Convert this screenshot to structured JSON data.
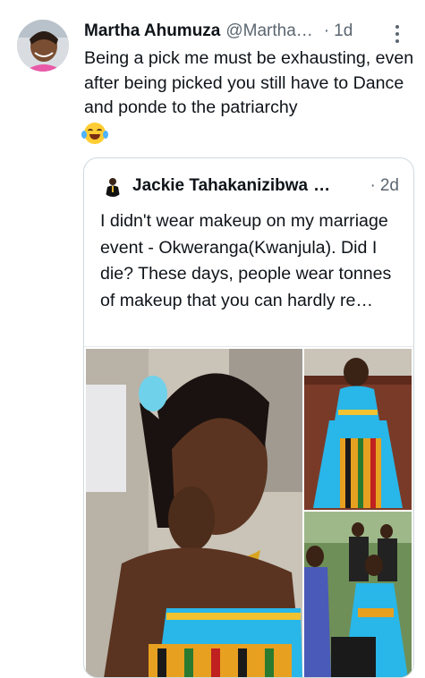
{
  "tweet": {
    "author_name": "Martha Ahumuza",
    "author_handle": "@Martha…",
    "separator": "·",
    "time": "1d",
    "text": "Being a pick me must be exhausting, even after being picked you still have to Dance and ponde to the patriarchy",
    "emoji": "face-with-tears-of-joy",
    "more_icon": "vertical-ellipsis-icon"
  },
  "quoted": {
    "author_name": "Jackie Tahakanizibwa",
    "name_ellipsis": "…",
    "separator": "·",
    "time": "2d",
    "text": "I didn't wear makeup on my marriage event - Okweranga(Kwanjula). Did I die? These days, people wear tonnes of makeup that you can hardly re…",
    "photos": [
      "woman-closeup-photo",
      "woman-seated-photo",
      "ceremony-photo"
    ]
  },
  "colors": {
    "text": "#0f1419",
    "secondary": "#5b6670",
    "border": "#cfd9de",
    "dress_blue": "#29b6e8"
  }
}
